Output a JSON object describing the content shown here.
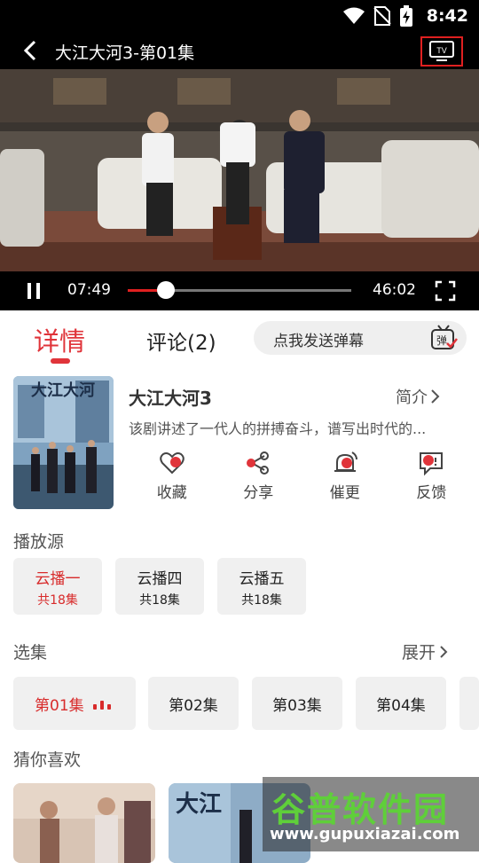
{
  "status_bar": {
    "time": "8:42"
  },
  "player": {
    "title": "大江大河3-第01集",
    "current_time": "07:49",
    "total_time": "46:02",
    "progress": 0.17
  },
  "tabs": {
    "detail": "详情",
    "comments": "评论(2)"
  },
  "danmu": {
    "placeholder": "点我发送弹幕",
    "icon_label": "弹"
  },
  "show": {
    "title": "大江大河3",
    "intro_label": "简介",
    "description": "该剧讲述了一代人的拼搏奋斗，谱写出时代的...",
    "actions": [
      {
        "label": "收藏",
        "icon": "heart-icon"
      },
      {
        "label": "分享",
        "icon": "share-icon"
      },
      {
        "label": "催更",
        "icon": "bell-icon"
      },
      {
        "label": "反馈",
        "icon": "feedback-icon"
      }
    ]
  },
  "sources": {
    "heading": "播放源",
    "items": [
      {
        "name": "云播一",
        "count": "共18集"
      },
      {
        "name": "云播四",
        "count": "共18集"
      },
      {
        "name": "云播五",
        "count": "共18集"
      }
    ]
  },
  "episodes": {
    "heading": "选集",
    "expand_label": "展开",
    "items": [
      "第01集",
      "第02集",
      "第03集",
      "第04集"
    ]
  },
  "recommend": {
    "heading": "猜你喜欢"
  },
  "watermark": {
    "name": "谷普软件园",
    "url": "www.gupuxiazai.com"
  },
  "colors": {
    "accent": "#e0343a",
    "cast_highlight": "#e02020"
  }
}
